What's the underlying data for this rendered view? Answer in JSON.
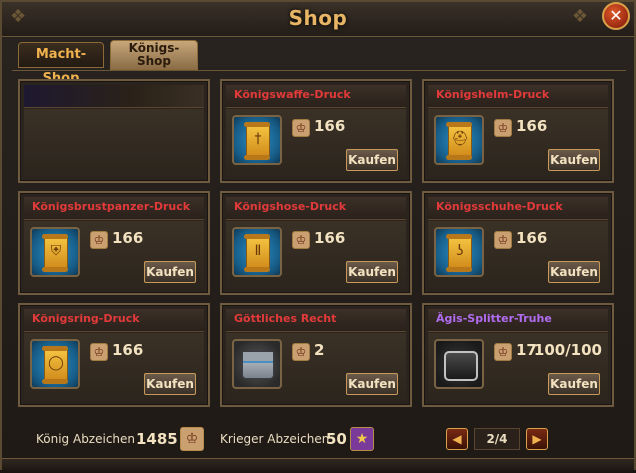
{
  "window": {
    "title": "Shop"
  },
  "tabs": [
    {
      "label": "Macht-Shop",
      "active": false
    },
    {
      "label": "Königs-\nShop",
      "active": true
    }
  ],
  "items": [
    {
      "title": "",
      "price": "",
      "buy_label": ""
    },
    {
      "title": "Königswaffe-Druck",
      "price": "166",
      "buy_label": "Kaufen",
      "icon": "scroll-weapon-icon"
    },
    {
      "title": "Königshelm-Druck",
      "price": "166",
      "buy_label": "Kaufen",
      "icon": "scroll-helmet-icon"
    },
    {
      "title": "Königsbrustpanzer-Druck",
      "price": "166",
      "buy_label": "Kaufen",
      "icon": "scroll-armor-icon"
    },
    {
      "title": "Königshose-Druck",
      "price": "166",
      "buy_label": "Kaufen",
      "icon": "scroll-pants-icon"
    },
    {
      "title": "Königsschuhe-Druck",
      "price": "166",
      "buy_label": "Kaufen",
      "icon": "scroll-boots-icon"
    },
    {
      "title": "Königsring-Druck",
      "price": "166",
      "buy_label": "Kaufen",
      "icon": "scroll-ring-icon"
    },
    {
      "title": "Göttliches Recht",
      "price": "2",
      "buy_label": "Kaufen",
      "icon": "chest-icon"
    },
    {
      "title": "Ägis-Splitter-Truhe",
      "price": "17",
      "stock": "100/100",
      "buy_label": "Kaufen",
      "icon": "aegis-chest-icon"
    }
  ],
  "footer": {
    "koenig_label": "König Abzeichen",
    "koenig_value": "1485",
    "krieger_label": "Krieger Abzeichen",
    "krieger_value": "50",
    "page": "2/4"
  },
  "colors": {
    "title_red": "#e23a3a",
    "title_purple": "#b06cf0",
    "gold": "#e8b465"
  }
}
